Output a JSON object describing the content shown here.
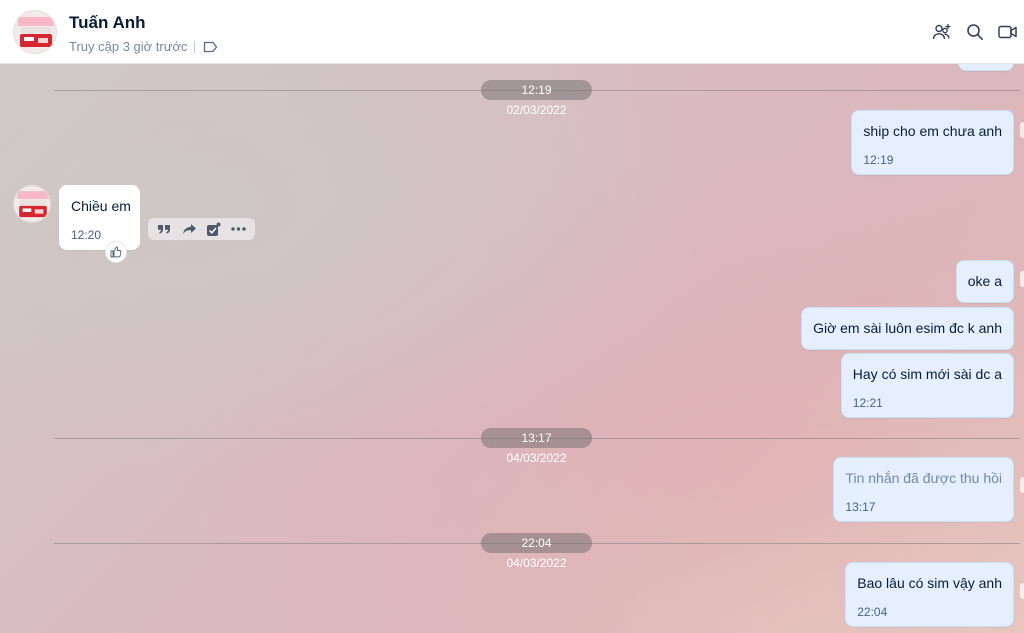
{
  "header": {
    "contact_name": "Tuấn Anh",
    "last_seen": "Truy cập 3 giờ trước",
    "icons": [
      "tag-icon",
      "add-to-group-icon",
      "search-icon",
      "video-call-icon"
    ]
  },
  "dates": [
    "12:19 02/03/2022",
    "13:17 04/03/2022",
    "22:04 04/03/2022"
  ],
  "messages": [
    {
      "side": "out",
      "text": "ship cho em chưa anh",
      "time": "12:19"
    },
    {
      "side": "in",
      "text": "Chiều em",
      "time": "12:20"
    },
    {
      "side": "out",
      "text": "oke a",
      "time": ""
    },
    {
      "side": "out",
      "text": "Giờ em sài luôn esim đc k anh",
      "time": ""
    },
    {
      "side": "out",
      "text": "Hay có sim mới sài dc a",
      "time": "12:21"
    },
    {
      "side": "out",
      "text": "Tin nhắn đã được thu hồi",
      "time": "13:17",
      "recalled": true
    },
    {
      "side": "out",
      "text": "Bao lâu có sim vậy anh",
      "time": "22:04"
    }
  ],
  "hover_toolbar": [
    "quote-icon",
    "forward-icon",
    "select-icon",
    "more-icon"
  ],
  "colors": {
    "bubble_out": "#e5efff",
    "bubble_in": "#ffffff",
    "text": "#081c36",
    "muted": "#7589a3"
  }
}
